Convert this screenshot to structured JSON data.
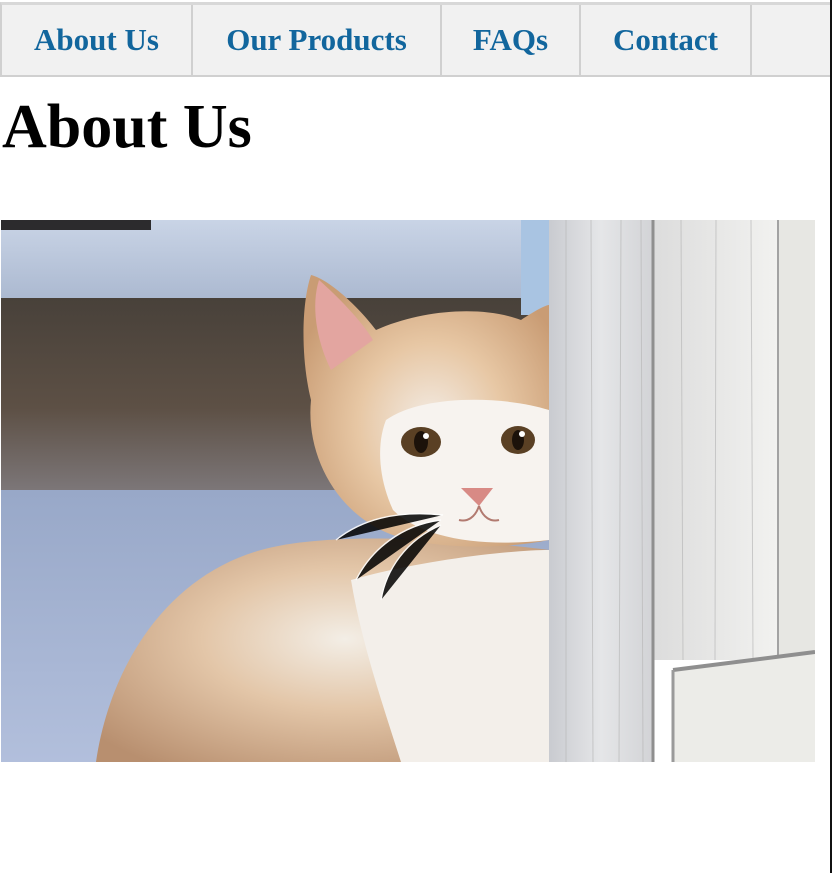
{
  "nav": {
    "items": [
      {
        "label": "About Us"
      },
      {
        "label": "Our Products"
      },
      {
        "label": "FAQs"
      },
      {
        "label": "Contact"
      },
      {
        "label": ""
      }
    ]
  },
  "page": {
    "title": "About Us"
  },
  "colors": {
    "link": "#12669d",
    "nav_bg": "#f1f1f1"
  }
}
